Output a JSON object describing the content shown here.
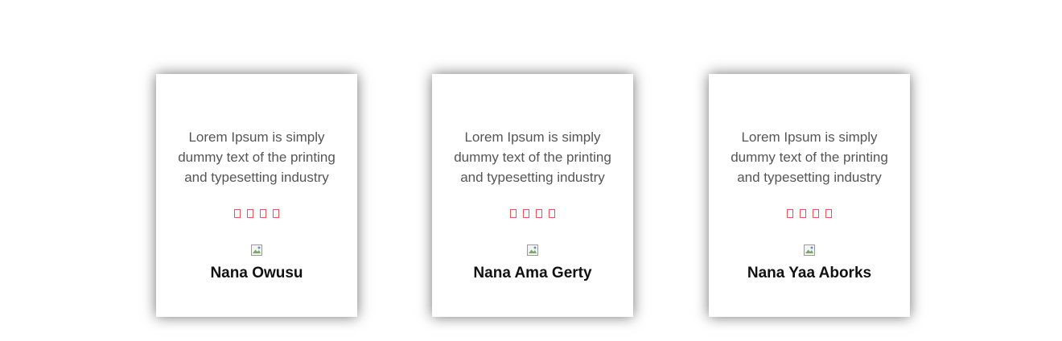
{
  "testimonials": [
    {
      "quote": "Lorem Ipsum is simply dummy text of the printing and typesetting industry",
      "rating": 4,
      "name": "Nana Owusu"
    },
    {
      "quote": "Lorem Ipsum is simply dummy text of the printing and typesetting industry",
      "rating": 4,
      "name": "Nana Ama Gerty"
    },
    {
      "quote": "Lorem Ipsum is simply dummy text of the printing and typesetting industry",
      "rating": 4,
      "name": "Nana Yaa Aborks"
    }
  ],
  "colors": {
    "star": "#e05a5a",
    "quote_text": "#555555",
    "name_text": "#111111"
  },
  "icons": {
    "star": "star-icon",
    "avatar": "broken-image-icon"
  }
}
